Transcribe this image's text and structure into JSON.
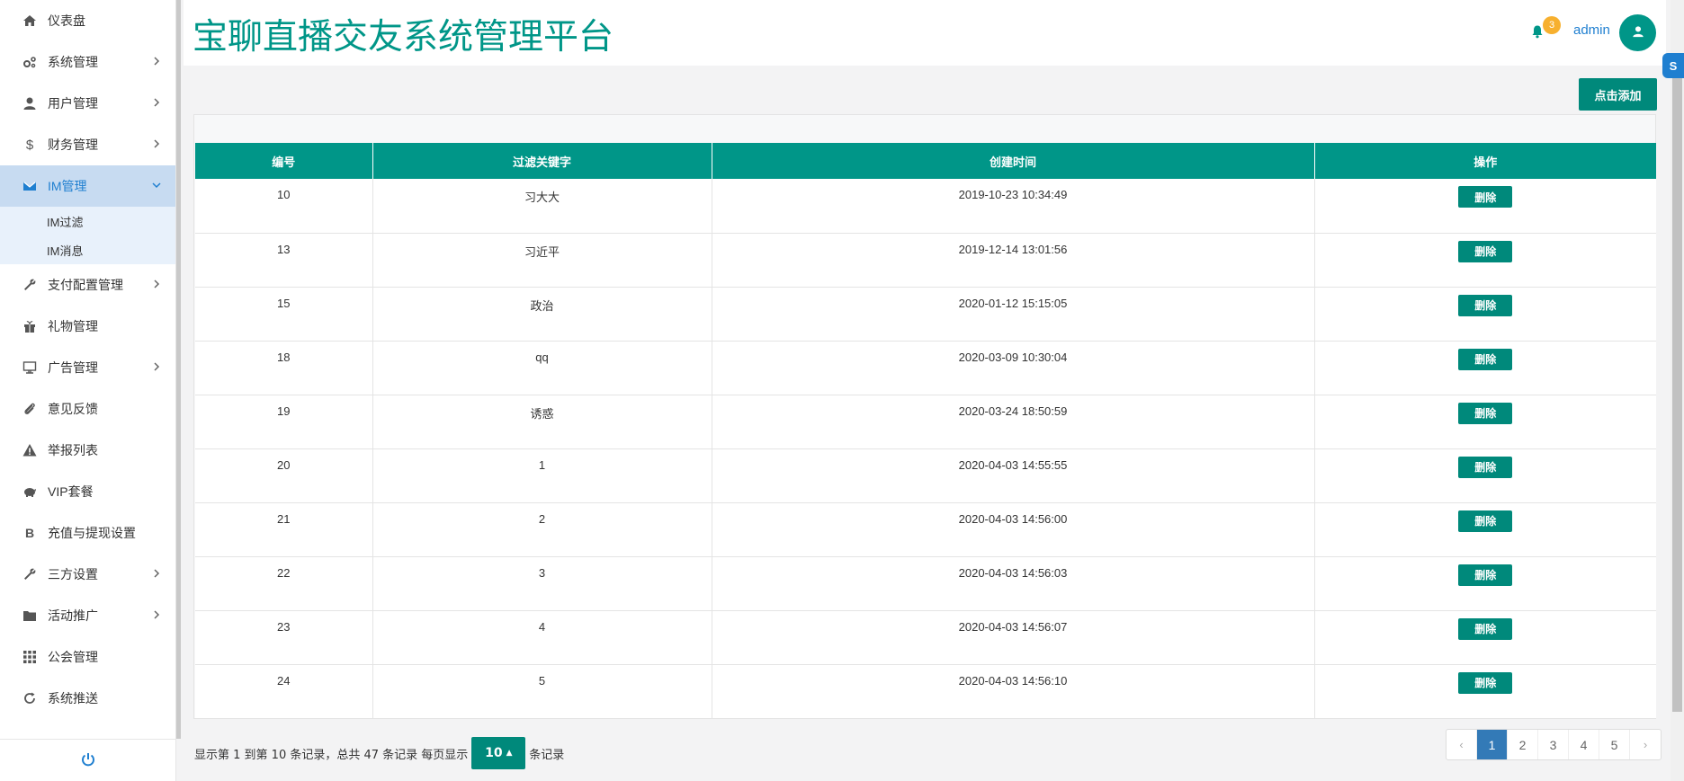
{
  "sidebar": {
    "items": [
      {
        "label": "仪表盘",
        "icon": "home-icon"
      },
      {
        "label": "系统管理",
        "icon": "cogs-icon"
      },
      {
        "label": "用户管理",
        "icon": "user-icon"
      },
      {
        "label": "财务管理",
        "icon": "dollar-icon"
      },
      {
        "label": "IM管理",
        "icon": "envelope-icon"
      },
      {
        "label": "支付配置管理",
        "icon": "wrench-icon"
      },
      {
        "label": "礼物管理",
        "icon": "gift-icon"
      },
      {
        "label": "广告管理",
        "icon": "billboard-icon"
      },
      {
        "label": "意见反馈",
        "icon": "paperclip-icon"
      },
      {
        "label": "举报列表",
        "icon": "warning-icon"
      },
      {
        "label": "VIP套餐",
        "icon": "piggy-bank-icon"
      },
      {
        "label": "充值与提现设置",
        "icon": "bitcoin-icon"
      },
      {
        "label": "三方设置",
        "icon": "wrench-icon"
      },
      {
        "label": "活动推广",
        "icon": "folder-icon"
      },
      {
        "label": "公会管理",
        "icon": "grid-icon"
      },
      {
        "label": "系统推送",
        "icon": "refresh-icon"
      }
    ],
    "sub_items": [
      "IM过滤",
      "IM消息"
    ]
  },
  "header": {
    "title": "宝聊直播交友系统管理平台",
    "notification_count": "3",
    "username": "admin"
  },
  "toolbar": {
    "add_label": "点击添加"
  },
  "table": {
    "headers": [
      "编号",
      "过滤关键字",
      "创建时间",
      "操作"
    ],
    "delete_label": "删除",
    "rows": [
      {
        "id": "10",
        "keyword": "习大大",
        "created": "2019-10-23 10:34:49"
      },
      {
        "id": "13",
        "keyword": "习近平",
        "created": "2019-12-14 13:01:56"
      },
      {
        "id": "15",
        "keyword": "政治",
        "created": "2020-01-12 15:15:05"
      },
      {
        "id": "18",
        "keyword": "qq",
        "created": "2020-03-09 10:30:04"
      },
      {
        "id": "19",
        "keyword": "诱惑",
        "created": "2020-03-24 18:50:59"
      },
      {
        "id": "20",
        "keyword": "1",
        "created": "2020-04-03 14:55:55"
      },
      {
        "id": "21",
        "keyword": "2",
        "created": "2020-04-03 14:56:00"
      },
      {
        "id": "22",
        "keyword": "3",
        "created": "2020-04-03 14:56:03"
      },
      {
        "id": "23",
        "keyword": "4",
        "created": "2020-04-03 14:56:07"
      },
      {
        "id": "24",
        "keyword": "5",
        "created": "2020-04-03 14:56:10"
      }
    ]
  },
  "footer": {
    "summary": "显示第 1 到第 10 条记录，总共 47 条记录 每页显示",
    "page_size": "10",
    "suffix": "条记录"
  },
  "pagination": {
    "prev": "‹",
    "pages": [
      "1",
      "2",
      "3",
      "4",
      "5"
    ],
    "current": "1",
    "next": "›"
  },
  "colors": {
    "primary": "#009688",
    "sidebar_active": "#c7dbf1",
    "link_blue": "#1f7fd0",
    "badge": "#f7b02f"
  }
}
